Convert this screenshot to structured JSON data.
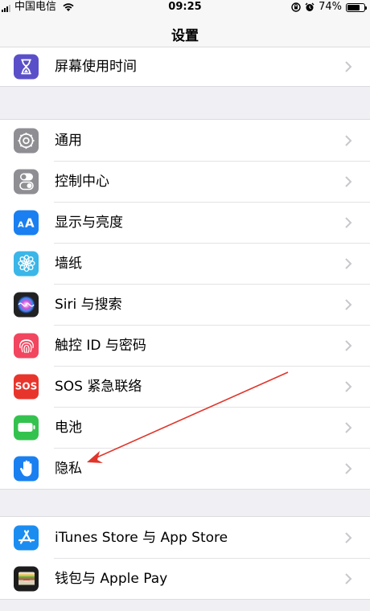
{
  "status_bar": {
    "carrier": "中国电信",
    "time": "09:25",
    "battery": "74%",
    "battery_level": 0.74
  },
  "nav": {
    "title": "设置"
  },
  "groups": [
    {
      "items": [
        {
          "label": "屏幕使用时间",
          "icon": "hourglass-icon",
          "color": "#5b4fc9"
        }
      ]
    },
    {
      "items": [
        {
          "label": "通用",
          "icon": "gear-icon",
          "color": "#8e8e93"
        },
        {
          "label": "控制中心",
          "icon": "toggles-icon",
          "color": "#8e8e93"
        },
        {
          "label": "显示与亮度",
          "icon": "text-size-icon",
          "color": "#1a7ff0"
        },
        {
          "label": "墙纸",
          "icon": "flower-icon",
          "color": "#3bb6e8"
        },
        {
          "label": "Siri 与搜索",
          "icon": "siri-icon",
          "color": "#222222"
        },
        {
          "label": "触控 ID 与密码",
          "icon": "fingerprint-icon",
          "color": "#f2455f"
        },
        {
          "label": "SOS 紧急联络",
          "icon": "sos-icon",
          "color": "#e8352c"
        },
        {
          "label": "电池",
          "icon": "battery-icon",
          "color": "#34c24f"
        },
        {
          "label": "隐私",
          "icon": "hand-icon",
          "color": "#1a7ff0"
        }
      ]
    },
    {
      "items": [
        {
          "label": "iTunes Store 与 App Store",
          "icon": "app-store-icon",
          "color": "#1b8df1"
        },
        {
          "label": "钱包与 Apple Pay",
          "icon": "wallet-icon",
          "color": "#1c1c1c"
        }
      ]
    }
  ],
  "sos_text": "SOS",
  "annotation": {
    "color": "#e0352b"
  }
}
